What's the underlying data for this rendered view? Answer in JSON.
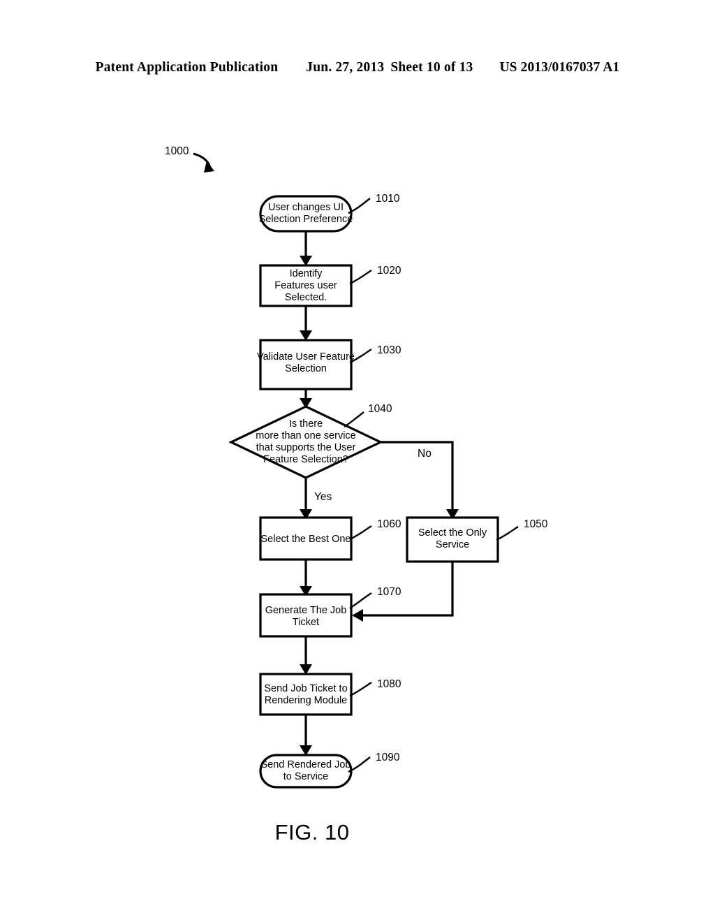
{
  "header": {
    "publication": "Patent Application Publication",
    "date": "Jun. 27, 2013",
    "sheet": "Sheet 10 of 13",
    "publication_number": "US 2013/0167037 A1"
  },
  "figure": {
    "caption": "FIG. 10",
    "diagram_reference": "1000"
  },
  "flowchart": {
    "nodes": [
      {
        "ref": "1010",
        "shape": "terminal",
        "lines": [
          "User changes UI",
          "Selection Preference"
        ]
      },
      {
        "ref": "1020",
        "shape": "process",
        "lines": [
          "Identify",
          "Features user",
          "Selected."
        ]
      },
      {
        "ref": "1030",
        "shape": "process",
        "lines": [
          "Validate User Feature",
          "Selection"
        ]
      },
      {
        "ref": "1040",
        "shape": "decision",
        "lines": [
          "Is there",
          "more than one service",
          "that supports the User",
          "Feature Selection?"
        ]
      },
      {
        "ref": "1060",
        "shape": "process",
        "lines": [
          "Select the Best One"
        ]
      },
      {
        "ref": "1050",
        "shape": "process",
        "lines": [
          "Select the Only",
          "Service"
        ]
      },
      {
        "ref": "1070",
        "shape": "process",
        "lines": [
          "Generate The Job",
          "Ticket"
        ]
      },
      {
        "ref": "1080",
        "shape": "process",
        "lines": [
          "Send Job Ticket to",
          "Rendering Module"
        ]
      },
      {
        "ref": "1090",
        "shape": "terminal",
        "lines": [
          "Send Rendered Job",
          "to Service"
        ]
      }
    ],
    "branch_labels": {
      "yes": "Yes",
      "no": "No"
    }
  },
  "colors": {
    "ink": "#000000",
    "paper": "#ffffff"
  }
}
